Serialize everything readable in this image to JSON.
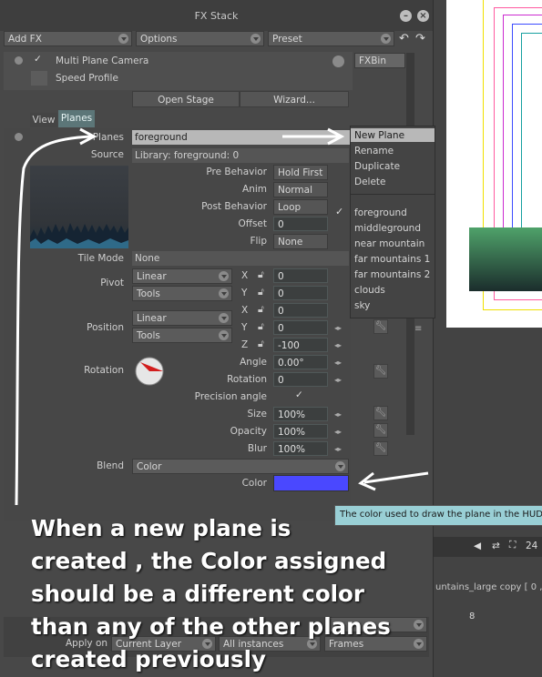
{
  "window": {
    "title": "FX Stack"
  },
  "toolbar": {
    "add_fx": "Add FX",
    "options": "Options",
    "preset": "Preset"
  },
  "fx": {
    "name": "Multi Plane Camera",
    "speed_profile": "Speed Profile",
    "fxbin": "FXBin"
  },
  "buttons": {
    "open_stage": "Open Stage",
    "wizard": "Wizard..."
  },
  "tabs": {
    "view": "View",
    "planes": "Planes"
  },
  "planes": {
    "label": "Planes",
    "value": "foreground"
  },
  "source": {
    "label": "Source",
    "value": "Library: foreground: 0"
  },
  "props": {
    "pre_behavior": {
      "label": "Pre Behavior",
      "value": "Hold First"
    },
    "anim": {
      "label": "Anim",
      "value": "Normal"
    },
    "post_behavior": {
      "label": "Post Behavior",
      "value": "Loop"
    },
    "offset": {
      "label": "Offset",
      "value": "0"
    },
    "flip": {
      "label": "Flip",
      "value": "None"
    },
    "tile_mode": {
      "label": "Tile Mode",
      "value": "None"
    },
    "pivot": {
      "label": "Pivot",
      "interp": "Linear",
      "tools": "Tools",
      "x_label": "X",
      "x": "0",
      "y_label": "Y",
      "y": "0"
    },
    "position": {
      "label": "Position",
      "interp": "Linear",
      "tools": "Tools",
      "x_label": "X",
      "x": "0",
      "y_label": "Y",
      "y": "0",
      "z_label": "Z",
      "z": "-100"
    },
    "rotation": {
      "label": "Rotation",
      "angle_label": "Angle",
      "angle": "0.00°",
      "rotation_label": "Rotation",
      "rotation": "0"
    },
    "precision_angle": {
      "label": "Precision angle"
    },
    "size": {
      "label": "Size",
      "value": "100%"
    },
    "opacity": {
      "label": "Opacity",
      "value": "100%"
    },
    "blur": {
      "label": "Blur",
      "value": "100%"
    },
    "blend": {
      "label": "Blend",
      "value": "Color"
    },
    "color": {
      "label": "Color",
      "swatch": "#4a48ff"
    }
  },
  "menu": {
    "actions": [
      "New Plane",
      "Rename",
      "Duplicate",
      "Delete"
    ],
    "planes": [
      "foreground",
      "middleground",
      "near mountain",
      "far mountains 1",
      "far mountains 2",
      "clouds",
      "sky"
    ],
    "checked": "foreground"
  },
  "bottom": {
    "apply_on": "Apply on",
    "current_layer": "Current Layer",
    "all_instances": "All instances",
    "frames": "Frames"
  },
  "background_app": {
    "timeline_text": "untains_large copy [ 0 ,",
    "frame_num": "8",
    "counter": "24"
  },
  "tooltip": "The color used to draw the plane in the HUD",
  "annotation": [
    "When a new plane is",
    "created , the Color assigned",
    "should be a different color",
    "than any of the other planes",
    "created previously"
  ],
  "colors": {
    "accent": "#9bd0d8",
    "swatch": "#4a48ff",
    "selected_menu": "#b8b8b8"
  }
}
